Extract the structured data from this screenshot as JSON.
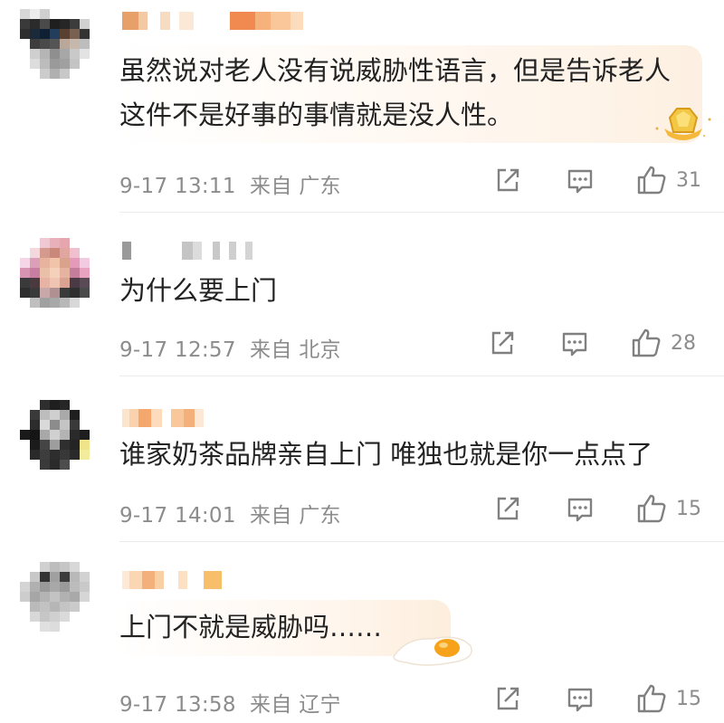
{
  "comments": [
    {
      "text": "虽然说对老人没有说威胁性语言，但是告诉老人这件不是好事的事情就是没人性。",
      "time": "9-17 13:11",
      "source": "来自 广东",
      "likes": "31"
    },
    {
      "text": "为什么要上门",
      "time": "9-17 12:57",
      "source": "来自 北京",
      "likes": "28"
    },
    {
      "text": "谁家奶茶品牌亲自上门 唯独也就是你一点点了",
      "time": "9-17 14:01",
      "source": "来自 广东",
      "likes": "15"
    },
    {
      "text": "上门不就是威胁吗……",
      "time": "9-17 13:58",
      "source": "来自 辽宁",
      "likes": "15"
    }
  ],
  "icons": {
    "repost": "share-out-icon",
    "reply": "comment-icon",
    "like": "thumbs-up-icon",
    "badge": "gold-badge-icon",
    "egg": "fried-egg-icon"
  },
  "colors": {
    "text": "#222222",
    "meta": "#8c8c8c",
    "bubble_warm": "#fdf3ea"
  }
}
